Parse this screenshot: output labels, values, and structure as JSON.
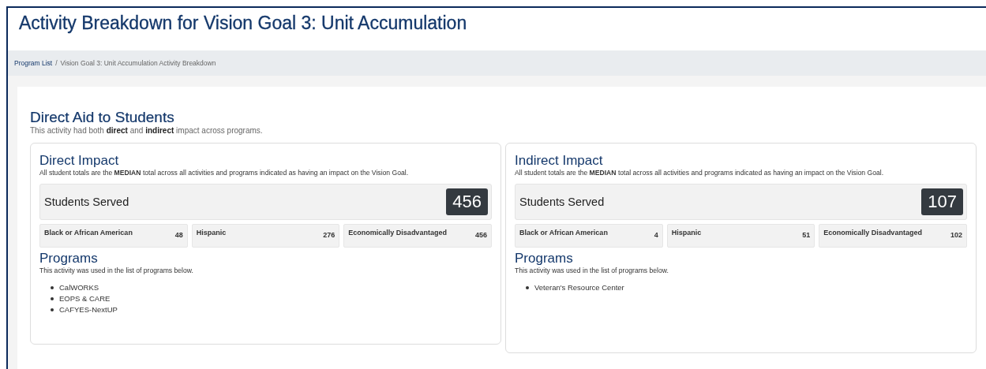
{
  "page_title": "Activity Breakdown for Vision Goal 3: Unit Accumulation",
  "breadcrumb": [
    {
      "label": "Program List",
      "kind": "link"
    },
    {
      "label": "/",
      "kind": "separator"
    },
    {
      "label": "Vision Goal 3: Unit Accumulation Activity Breakdown",
      "kind": "current"
    }
  ],
  "activity": {
    "title": "Direct Aid to Students",
    "description": "This activity had both **direct** and **indirect** impact across programs.",
    "panels": [
      {
        "title": "Direct Impact",
        "note": "All student totals are the **MEDIAN** total across all activities and programs indicated as having an impact on the Vision Goal.",
        "served_label": "Students Served",
        "served_total": "456",
        "groups": [
          {
            "label": "Black or African American",
            "count": "48"
          },
          {
            "label": "Hispanic",
            "count": "276"
          },
          {
            "label": "Economically Disadvantaged",
            "count": "456"
          }
        ],
        "programs_title": "Programs",
        "programs_note": "This activity was used in the list of programs below.",
        "programs": [
          "CalWORKS",
          "EOPS & CARE",
          "CAFYES-NextUP"
        ]
      },
      {
        "title": "Indirect Impact",
        "note": "All student totals are the **MEDIAN** total across all activities and programs indicated as having an impact on the Vision Goal.",
        "served_label": "Students Served",
        "served_total": "107",
        "groups": [
          {
            "label": "Black or African American",
            "count": "4"
          },
          {
            "label": "Hispanic",
            "count": "51"
          },
          {
            "label": "Economically Disadvantaged",
            "count": "102"
          }
        ],
        "programs_title": "Programs",
        "programs_note": "This activity was used in the list of programs below.",
        "programs": [
          "Veteran's Resource Center"
        ]
      }
    ]
  }
}
